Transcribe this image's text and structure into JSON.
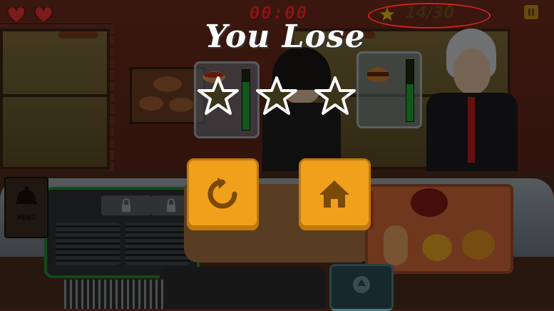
{
  "hud": {
    "lives": 2,
    "timer": "00:00",
    "score": "14/30",
    "icons": [
      "heart-icon",
      "star-icon",
      "pause-icon"
    ]
  },
  "result": {
    "title": "You Lose",
    "stars_earned": 0,
    "stars_total": 3
  },
  "orders": [
    {
      "item_icon": "hotdog-icon",
      "patience": 0.8
    },
    {
      "item_icon": "burger-icon",
      "patience": 0.6
    }
  ],
  "buttons": {
    "restart_icon": "restart-icon",
    "home_icon": "home-icon"
  },
  "kitchen": {
    "menu_label": "MENU",
    "icons": [
      "lock-icon",
      "recycle-icon",
      "menu-cloche-icon"
    ]
  },
  "colors": {
    "accent_button": "#f0a01a",
    "timer": "#8a1414",
    "score_highlight": "#d42020",
    "patience_bar": "#22a030"
  }
}
